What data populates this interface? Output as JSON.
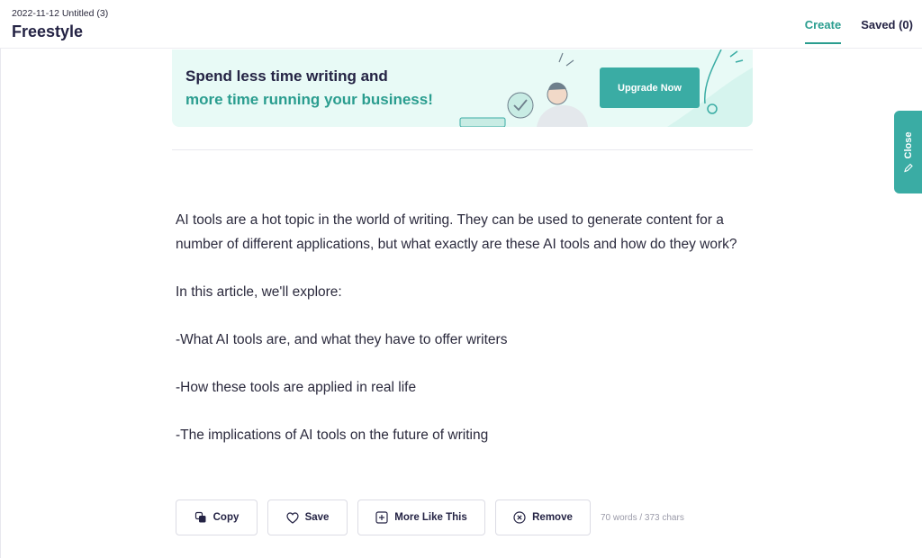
{
  "header": {
    "doc_meta": "2022-11-12 Untitled (3)",
    "doc_title": "Freestyle",
    "tabs": [
      {
        "label": "Create",
        "active": true
      },
      {
        "label": "Saved (0)",
        "active": false
      }
    ]
  },
  "banner": {
    "line1": "Spend less time writing and",
    "line2": "more time running your business!",
    "button_label": "Upgrade Now"
  },
  "article": {
    "paragraphs": [
      "AI tools are a hot topic in the world of writing. They can be used to generate content for a number of different applications, but what exactly are these AI tools and how do they work?",
      "In this article, we'll explore:",
      "-What AI tools are, and what they have to offer writers",
      "-How these tools are applied in real life",
      "-The implications of AI tools on the future of writing"
    ]
  },
  "actions": {
    "copy_label": "Copy",
    "save_label": "Save",
    "more_label": "More Like This",
    "remove_label": "Remove",
    "word_count": "70 words / 373 chars"
  },
  "side_panel": {
    "close_label": "Close"
  },
  "colors": {
    "accent": "#3aaca4",
    "accent_text": "#2a9d8f",
    "banner_bg": "#e8faf6",
    "text_dark": "#242344"
  }
}
